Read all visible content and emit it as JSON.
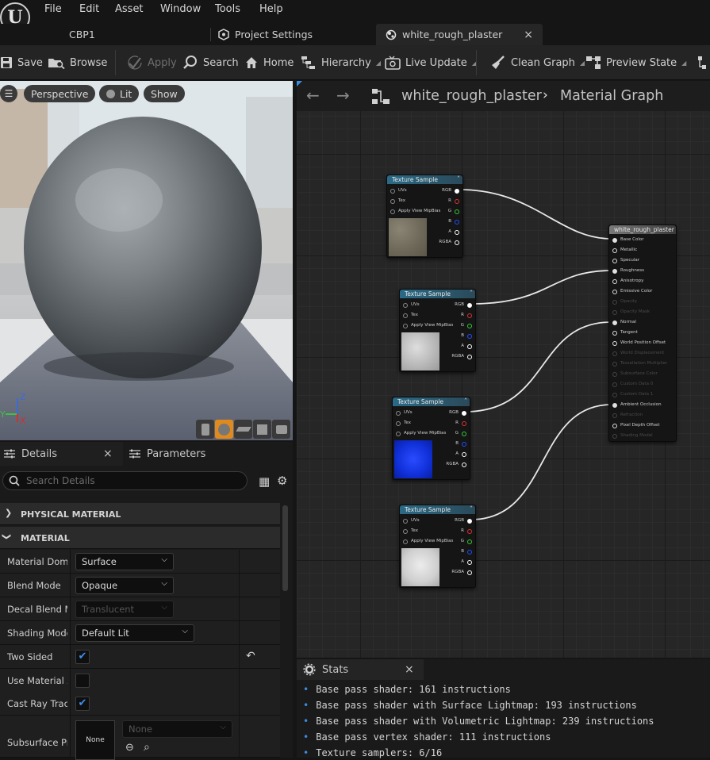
{
  "menu": [
    "File",
    "Edit",
    "Asset",
    "Window",
    "Tools",
    "Help"
  ],
  "tabs": {
    "cbp": "CBP1",
    "project_settings": "Project Settings",
    "material": "white_rough_plaster"
  },
  "toolbar": {
    "save": "Save",
    "browse": "Browse",
    "apply": "Apply",
    "search": "Search",
    "home": "Home",
    "hierarchy": "Hierarchy",
    "live_update": "Live Update",
    "clean_graph": "Clean Graph",
    "preview_state": "Preview State"
  },
  "viewport": {
    "perspective": "Perspective",
    "lit": "Lit",
    "show": "Show",
    "axis_z": "Z",
    "axis_x": "X",
    "axis_y": "Y"
  },
  "details": {
    "tab_details": "Details",
    "tab_parameters": "Parameters",
    "search_placeholder": "Search Details",
    "section_physical": "PHYSICAL MATERIAL",
    "section_material": "MATERIAL",
    "rows": [
      {
        "label": "Material Doma",
        "value": "Surface"
      },
      {
        "label": "Blend Mode",
        "value": "Opaque"
      },
      {
        "label": "Decal Blend M",
        "value": "Translucent"
      },
      {
        "label": "Shading Model",
        "value": "Default Lit"
      },
      {
        "label": "Two Sided",
        "value": "checked"
      },
      {
        "label": "Use Material A",
        "value": "unchecked"
      },
      {
        "label": "Cast Ray Trace",
        "value": "checked"
      },
      {
        "label": "Subsurface Pr",
        "value": "None",
        "combo": "None"
      }
    ]
  },
  "graph": {
    "crumb_asset": "white_rough_plaster",
    "crumb_graph": "Material Graph",
    "texture_node_title": "Texture Sample",
    "texture_pins_left": [
      "UVs",
      "Tex",
      "Apply View MipBias"
    ],
    "texture_pins_right": [
      "RGB",
      "R",
      "G",
      "B",
      "A",
      "RGBA"
    ],
    "material_node_title": "white_rough_plaster",
    "material_pins": [
      "Base Color",
      "Metallic",
      "Specular",
      "Roughness",
      "Anisotropy",
      "Emissive Color",
      "Opacity",
      "Opacity Mask",
      "Normal",
      "Tangent",
      "World Position Offset",
      "World Displacement",
      "Tessellation Multiplier",
      "Subsurface Color",
      "Custom Data 0",
      "Custom Data 1",
      "Ambient Occlusion",
      "Refraction",
      "Pixel Depth Offset",
      "Shading Model"
    ],
    "material_pins_disabled": [
      6,
      7,
      11,
      12,
      13,
      14,
      15,
      17,
      19
    ],
    "colors": {
      "title": "#2a6a86",
      "wire": "#e8e8e8",
      "r": "#e03030",
      "g": "#30d030",
      "b": "#2050ff"
    }
  },
  "stats": {
    "title": "Stats",
    "lines": [
      "Base pass shader: 161 instructions",
      "Base pass shader with Surface Lightmap: 193 instructions",
      "Base pass shader with Volumetric Lightmap: 239 instructions",
      "Base pass vertex shader: 111 instructions",
      "Texture samplers: 6/16"
    ]
  }
}
